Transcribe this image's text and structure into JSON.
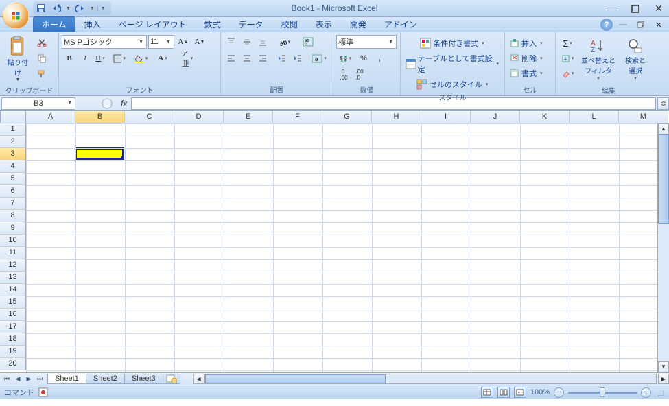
{
  "title": "Book1 - Microsoft Excel",
  "qat": {
    "save": "💾",
    "undo": "↶",
    "redo": "↷"
  },
  "tabs": [
    "ホーム",
    "挿入",
    "ページ レイアウト",
    "数式",
    "データ",
    "校閲",
    "表示",
    "開発",
    "アドイン"
  ],
  "ribbon": {
    "clipboard": {
      "label": "クリップボード",
      "paste": "貼り付け"
    },
    "font": {
      "label": "フォント",
      "name": "MS Pゴシック",
      "size": "11"
    },
    "alignment": {
      "label": "配置"
    },
    "number": {
      "label": "数値",
      "format": "標準"
    },
    "styles": {
      "label": "スタイル",
      "conditional": "条件付き書式",
      "table_format": "テーブルとして書式設定",
      "cell_styles": "セルのスタイル"
    },
    "cells": {
      "label": "セル",
      "insert": "挿入",
      "delete": "削除",
      "format": "書式"
    },
    "editing": {
      "label": "編集",
      "sort": "並べ替えと\nフィルタ",
      "find": "検索と\n選択"
    }
  },
  "name_box": "B3",
  "columns": [
    "A",
    "B",
    "C",
    "D",
    "E",
    "F",
    "G",
    "H",
    "I",
    "J",
    "K",
    "L",
    "M"
  ],
  "rows": [
    "1",
    "2",
    "3",
    "4",
    "5",
    "6",
    "7",
    "8",
    "9",
    "10",
    "11",
    "12",
    "13",
    "14",
    "15",
    "16",
    "17",
    "18",
    "19",
    "20"
  ],
  "selected": {
    "col": 1,
    "row": 2
  },
  "sheets": [
    "Sheet1",
    "Sheet2",
    "Sheet3"
  ],
  "status": {
    "left": "コマンド",
    "zoom": "100%"
  }
}
